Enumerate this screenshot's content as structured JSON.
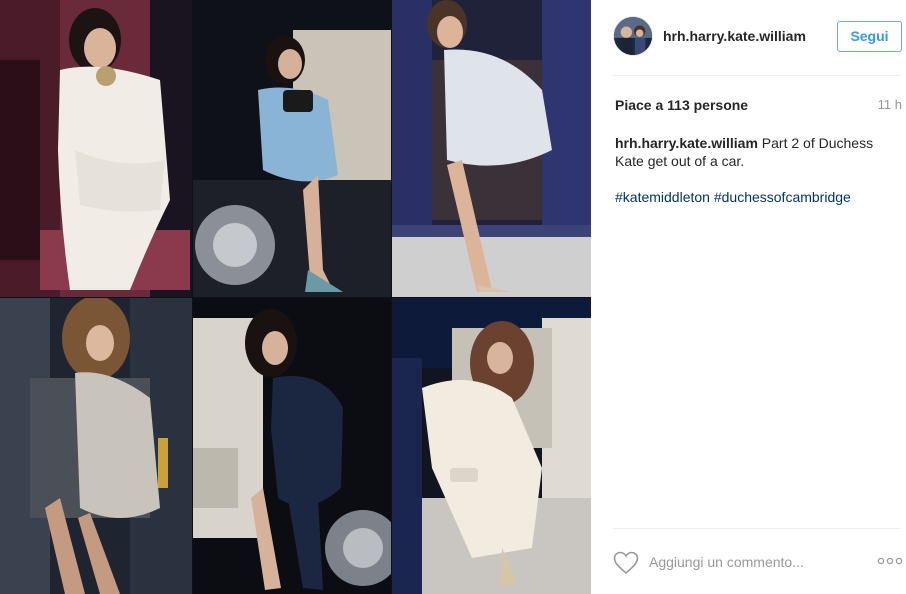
{
  "post": {
    "username": "hrh.harry.kate.william",
    "follow_label": "Segui",
    "likes_text": "Piace a 113 persone",
    "time_ago": "11 h",
    "caption_user": "hrh.harry.kate.william",
    "caption_text": " Part 2 of Duchess Kate get out of a car.",
    "hashtags": [
      "#katemiddleton",
      "#duchessofcambridge"
    ],
    "comment_placeholder": "Aggiungi un commento..."
  },
  "colors": {
    "link_blue": "#3897f0",
    "hashtag_blue": "#003569",
    "muted_gray": "#999999",
    "text_dark": "#262626"
  },
  "icons": {
    "like": "heart-outline-icon",
    "more": "more-options-icon"
  }
}
